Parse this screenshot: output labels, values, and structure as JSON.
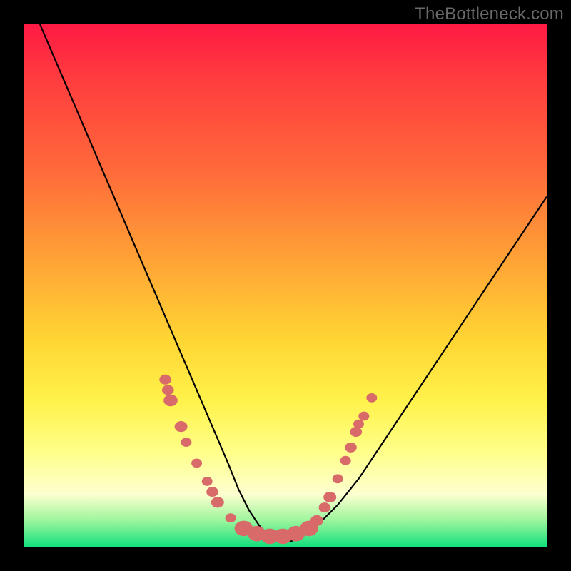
{
  "watermark": "TheBottleneck.com",
  "colors": {
    "frame": "#000000",
    "curve": "#000000",
    "marker_fill": "#d86a6a",
    "marker_stroke": "#c45858"
  },
  "chart_data": {
    "type": "line",
    "title": "",
    "xlabel": "",
    "ylabel": "",
    "xlim": [
      0,
      100
    ],
    "ylim": [
      0,
      100
    ],
    "grid": false,
    "legend": false,
    "series": [
      {
        "name": "bottleneck-curve",
        "x": [
          3,
          6,
          9,
          12,
          15,
          18,
          21,
          24,
          27,
          30,
          33,
          36,
          39,
          41,
          43,
          45,
          47,
          49,
          51,
          53,
          56,
          60,
          64,
          68,
          72,
          76,
          80,
          84,
          88,
          92,
          96,
          100
        ],
        "y": [
          100,
          93,
          86,
          79,
          72,
          65,
          58,
          51,
          44,
          37,
          30,
          23,
          16,
          11,
          7,
          4,
          2,
          1,
          1,
          2,
          4,
          8,
          13,
          19,
          25,
          31,
          37,
          43,
          49,
          55,
          61,
          67
        ]
      }
    ],
    "markers": [
      {
        "x": 27,
        "y": 32,
        "r": 1.1
      },
      {
        "x": 27.5,
        "y": 30,
        "r": 1.1
      },
      {
        "x": 28,
        "y": 28,
        "r": 1.3
      },
      {
        "x": 30,
        "y": 23,
        "r": 1.2
      },
      {
        "x": 31,
        "y": 20,
        "r": 1.0
      },
      {
        "x": 33,
        "y": 16,
        "r": 1.0
      },
      {
        "x": 35,
        "y": 12.5,
        "r": 1.0
      },
      {
        "x": 36,
        "y": 10.5,
        "r": 1.1
      },
      {
        "x": 37,
        "y": 8.5,
        "r": 1.2
      },
      {
        "x": 39.5,
        "y": 5.5,
        "r": 1.0
      },
      {
        "x": 42,
        "y": 3.5,
        "r": 1.7
      },
      {
        "x": 44.5,
        "y": 2.5,
        "r": 1.7
      },
      {
        "x": 47,
        "y": 2.0,
        "r": 1.7
      },
      {
        "x": 49.5,
        "y": 2.0,
        "r": 1.7
      },
      {
        "x": 52,
        "y": 2.5,
        "r": 1.7
      },
      {
        "x": 54.5,
        "y": 3.5,
        "r": 1.7
      },
      {
        "x": 56,
        "y": 5.0,
        "r": 1.2
      },
      {
        "x": 57.5,
        "y": 7.5,
        "r": 1.1
      },
      {
        "x": 58.5,
        "y": 9.5,
        "r": 1.2
      },
      {
        "x": 60,
        "y": 13,
        "r": 1.0
      },
      {
        "x": 61.5,
        "y": 16.5,
        "r": 1.0
      },
      {
        "x": 62.5,
        "y": 19,
        "r": 1.1
      },
      {
        "x": 63.5,
        "y": 22,
        "r": 1.1
      },
      {
        "x": 65,
        "y": 25,
        "r": 1.0
      },
      {
        "x": 64,
        "y": 23.5,
        "r": 1.0
      },
      {
        "x": 66.5,
        "y": 28.5,
        "r": 1.0
      }
    ]
  }
}
